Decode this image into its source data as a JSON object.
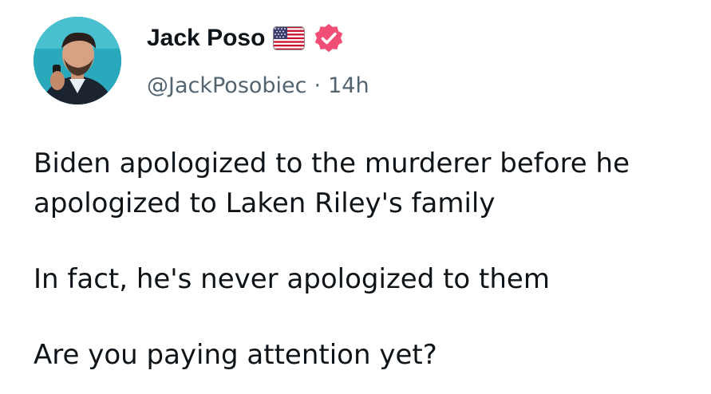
{
  "author": {
    "display_name": "Jack Poso",
    "handle": "@JackPosobiec",
    "separator": "·",
    "timestamp": "14h",
    "flag_icon": "us-flag-icon",
    "verified_icon": "verified-badge-icon",
    "verified_color": "#f04e75"
  },
  "post": {
    "paragraphs": [
      "Biden apologized to the murderer before he apologized to Laken Riley's family",
      "In fact, he's never apologized to them",
      "Are you paying attention yet?"
    ]
  }
}
